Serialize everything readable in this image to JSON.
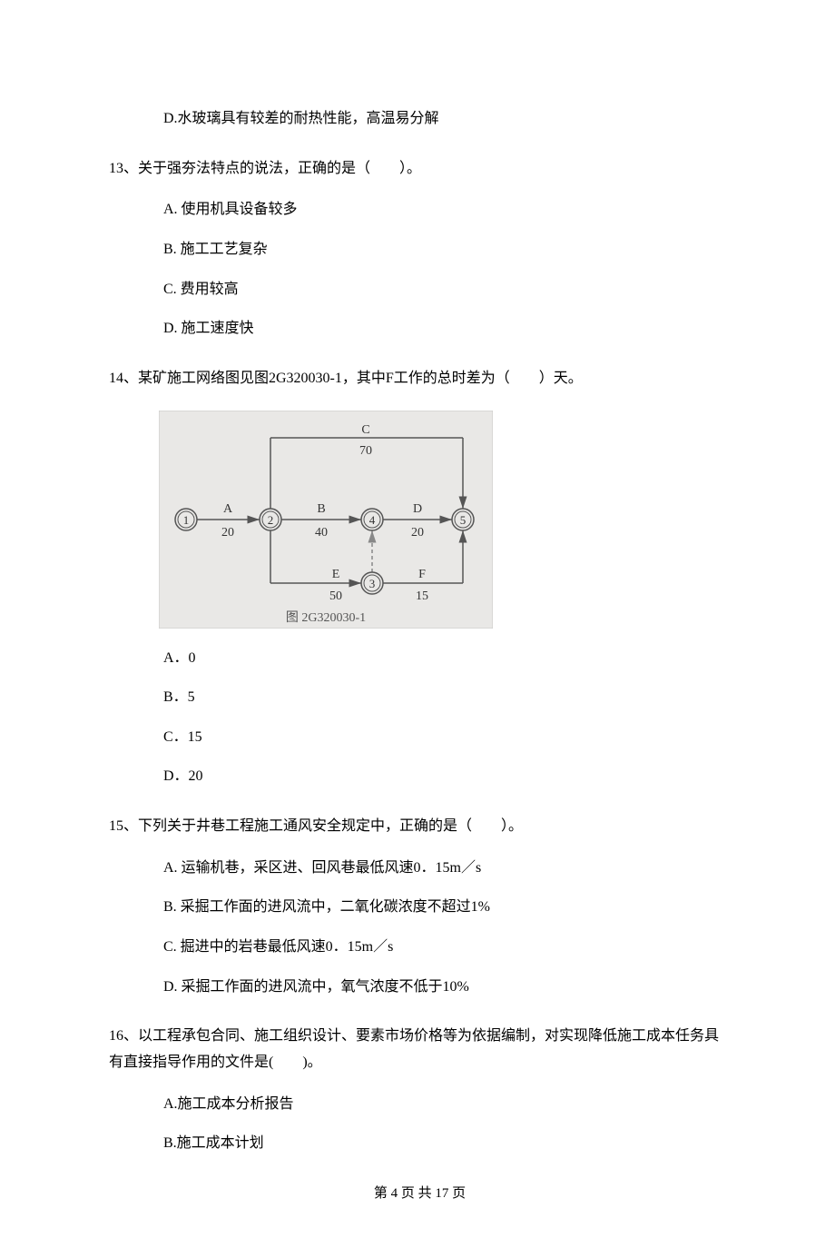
{
  "q12": {
    "optD": "D.水玻璃具有较差的耐热性能，高温易分解"
  },
  "q13": {
    "stem": "13、关于强夯法特点的说法，正确的是（　　）。",
    "optA": "A.  使用机具设备较多",
    "optB": "B.  施工工艺复杂",
    "optC": "C.  费用较高",
    "optD": "D.  施工速度快"
  },
  "q14": {
    "stem": "14、某矿施工网络图见图2G320030-1，其中F工作的总时差为（　　）天。",
    "diagram": {
      "caption": "图 2G320030-1",
      "nodes": [
        "1",
        "2",
        "3",
        "4",
        "5"
      ],
      "edges": {
        "A": {
          "label": "A",
          "dur": "20"
        },
        "B": {
          "label": "B",
          "dur": "40"
        },
        "C": {
          "label": "C",
          "dur": "70"
        },
        "D": {
          "label": "D",
          "dur": "20"
        },
        "E": {
          "label": "E",
          "dur": "50"
        },
        "F": {
          "label": "F",
          "dur": "15"
        }
      }
    },
    "optA": "A．0",
    "optB": "B．5",
    "optC": "C．15",
    "optD": "D．20"
  },
  "q15": {
    "stem": "15、下列关于井巷工程施工通风安全规定中，正确的是（　　）。",
    "optA": "A.  运输机巷，采区进、回风巷最低风速0．15m／s",
    "optB": "B.  采掘工作面的进风流中，二氧化碳浓度不超过1%",
    "optC": "C.  掘进中的岩巷最低风速0．15m／s",
    "optD": "D.  采掘工作面的进风流中，氧气浓度不低于10%"
  },
  "q16": {
    "stem": "16、以工程承包合同、施工组织设计、要素市场价格等为依据编制，对实现降低施工成本任务具有直接指导作用的文件是(　　)。",
    "optA": "A.施工成本分析报告",
    "optB": "B.施工成本计划"
  },
  "footer": "第 4 页 共 17 页"
}
